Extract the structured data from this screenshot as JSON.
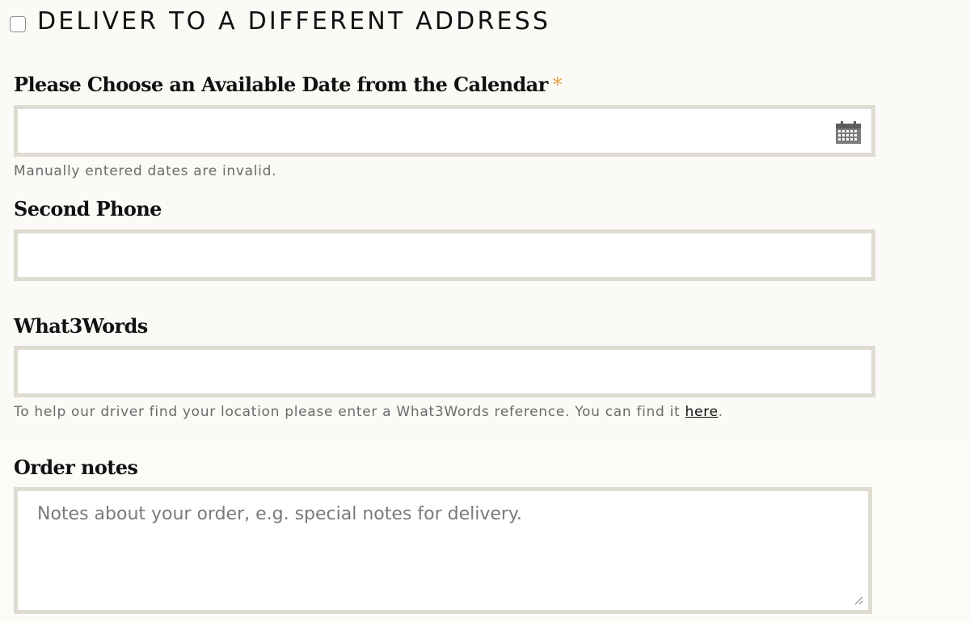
{
  "deliver": {
    "label": "DELIVER TO A DIFFERENT ADDRESS",
    "checked": false
  },
  "delivery_date": {
    "label": "Please Choose an Available Date from the Calendar",
    "required_marker": "*",
    "value": "",
    "help": "Manually entered dates are invalid.",
    "icon": "calendar-icon"
  },
  "second_phone": {
    "label": "Second Phone",
    "value": ""
  },
  "what3words": {
    "label": "What3Words",
    "value": "",
    "help_prefix": "To help our driver find your location please enter a What3Words reference. You can find it ",
    "help_link": "here",
    "help_suffix": "."
  },
  "order_notes": {
    "label": "Order notes",
    "placeholder": "Notes about your order, e.g. special notes for delivery.",
    "value": ""
  },
  "colors": {
    "background": "#fbfaf6",
    "field_border": "#dedcd1",
    "required": "#e6a24a",
    "help_text": "#6b6b6b"
  }
}
